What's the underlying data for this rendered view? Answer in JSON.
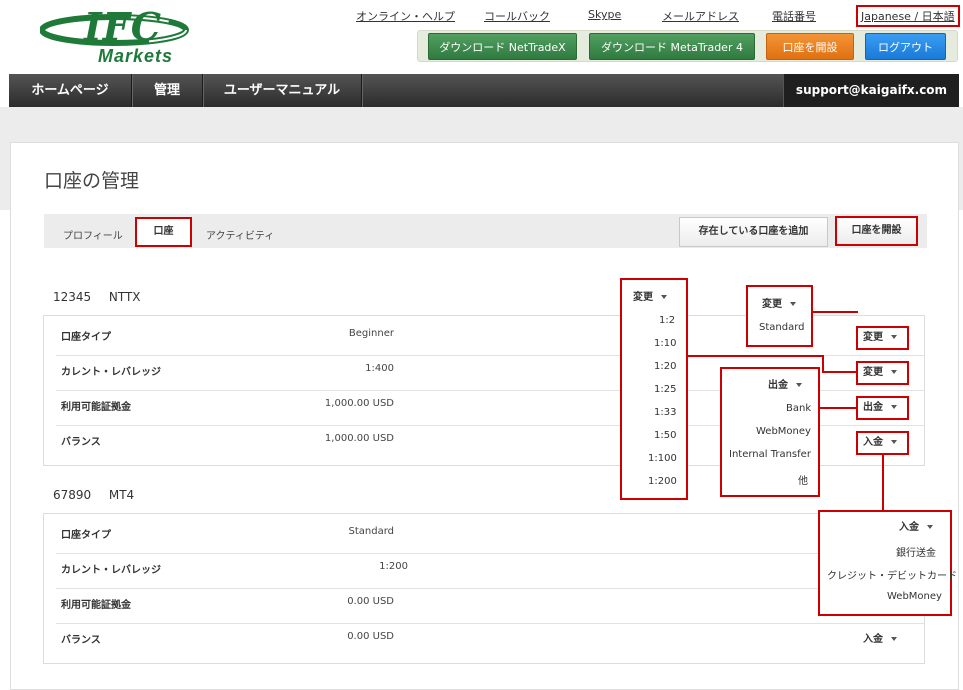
{
  "header": {
    "logo_text": "IFC",
    "logo_sub": "Markets",
    "links": [
      "オンライン・ヘルプ",
      "コールバック",
      "Skype",
      "メールアドレス",
      "電話番号"
    ],
    "language": "Japanese / 日本語",
    "buttons": {
      "download_nettradex": "ダウンロード NetTradeX",
      "download_mt4": "ダウンロード MetaTrader 4",
      "open_account": "口座を開設",
      "logout": "ログアウト"
    }
  },
  "nav": {
    "items": [
      "ホームページ",
      "管理",
      "ユーザーマニュアル"
    ],
    "support_email": "support@kaigaifx.com"
  },
  "page": {
    "title": "口座の管理",
    "tabs": [
      "プロフィール",
      "口座",
      "アクティビティ"
    ],
    "add_existing": "存在している口座を追加",
    "open_account": "口座を開設"
  },
  "accounts": [
    {
      "number": "12345",
      "platform": "NTTX",
      "rows": [
        {
          "label": "口座タイプ",
          "value": "Beginner",
          "action": "変更"
        },
        {
          "label": "カレント・レバレッジ",
          "value": "1:400",
          "action": "変更"
        },
        {
          "label": "利用可能証拠金",
          "value": "1,000.00 USD",
          "action": "出金"
        },
        {
          "label": "バランス",
          "value": "1,000.00 USD",
          "action": "入金"
        }
      ]
    },
    {
      "number": "67890",
      "platform": "MT4",
      "rows": [
        {
          "label": "口座タイプ",
          "value": "Standard"
        },
        {
          "label": "カレント・レバレッジ",
          "value": "1:200"
        },
        {
          "label": "利用可能証拠金",
          "value": "0.00 USD"
        },
        {
          "label": "バランス",
          "value": "0.00 USD",
          "action": "入金"
        }
      ]
    }
  ],
  "popups": {
    "leverage": {
      "title": "変更",
      "options": [
        "1:2",
        "1:10",
        "1:20",
        "1:25",
        "1:33",
        "1:50",
        "1:100",
        "1:200"
      ]
    },
    "account_type": {
      "title": "変更",
      "options": [
        "Standard"
      ]
    },
    "withdraw": {
      "title": "出金",
      "options": [
        "Bank",
        "WebMoney",
        "Internal Transfer",
        "他"
      ]
    },
    "deposit": {
      "title": "入金",
      "options": [
        "銀行送金",
        "クレジット・デビットカード",
        "WebMoney"
      ]
    }
  },
  "colors": {
    "accent_red": "#cc0000",
    "logo_green": "#1f7a3a",
    "nav_dark": "#333333"
  }
}
